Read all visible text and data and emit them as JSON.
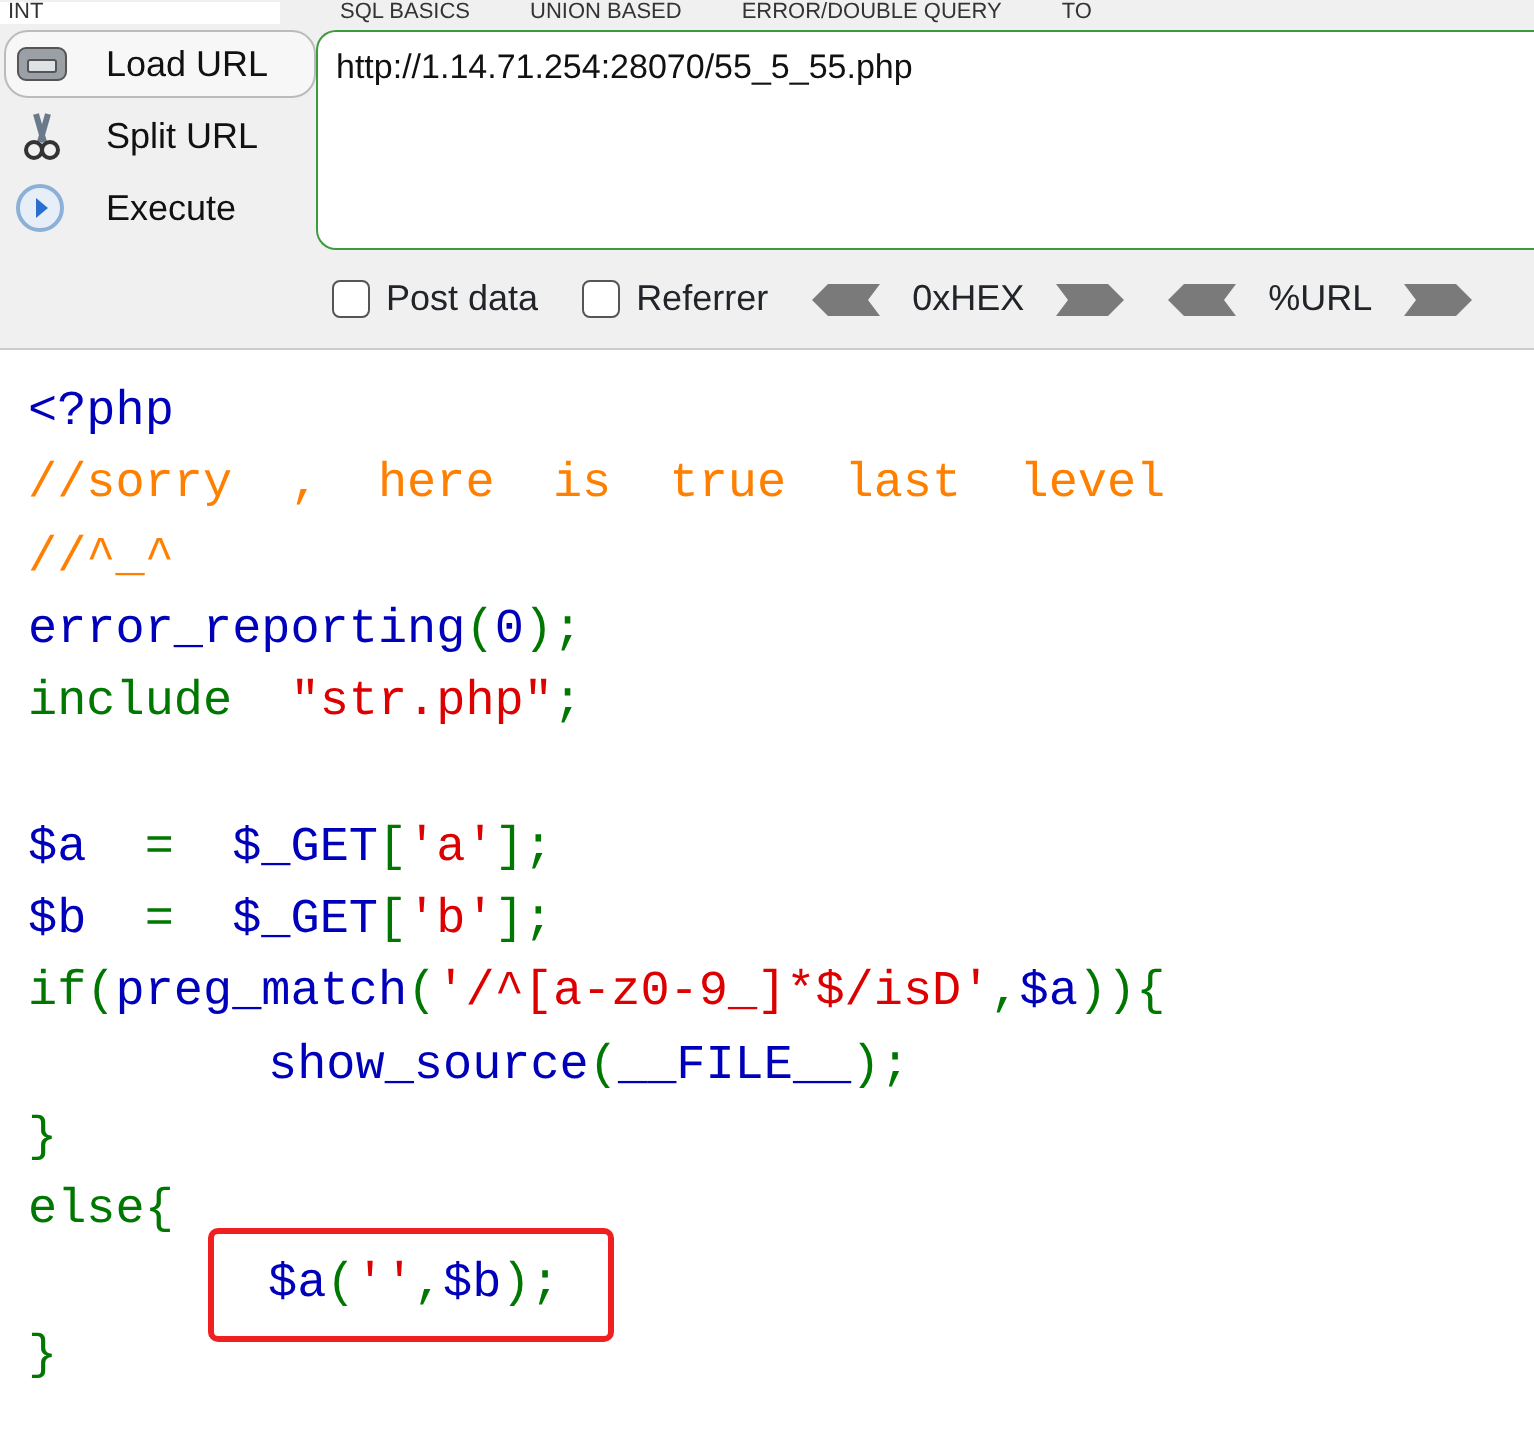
{
  "menu": {
    "field_value": "INT",
    "items": [
      "SQL BASICS",
      "UNION BASED",
      "ERROR/DOUBLE QUERY",
      "TO"
    ]
  },
  "actions": [
    {
      "label": "Load URL",
      "kind": "load",
      "selected": true
    },
    {
      "label": "Split URL",
      "kind": "split",
      "selected": false
    },
    {
      "label": "Execute",
      "kind": "execute",
      "selected": false
    }
  ],
  "url": {
    "value": "http://1.14.71.254:28070/55_5_55.php"
  },
  "options": [
    {
      "label": "Post data",
      "checked": false
    },
    {
      "label": "Referrer",
      "checked": false
    }
  ],
  "encoders": [
    "0xHEX",
    "%URL"
  ],
  "code": [
    {
      "kind": "code",
      "indented": false,
      "boxed": false,
      "tokens": [
        {
          "kind": "default",
          "text": "<?php"
        }
      ]
    },
    {
      "kind": "code",
      "indented": false,
      "boxed": false,
      "tokens": [
        {
          "kind": "comment",
          "text": "//sorry  ,  here  is  true  last  level"
        }
      ]
    },
    {
      "kind": "code",
      "indented": false,
      "boxed": false,
      "tokens": [
        {
          "kind": "comment",
          "text": "//^_^"
        }
      ]
    },
    {
      "kind": "code",
      "indented": false,
      "boxed": false,
      "tokens": [
        {
          "kind": "default",
          "text": "error_reporting"
        },
        {
          "kind": "keyword",
          "text": "("
        },
        {
          "kind": "default",
          "text": "0"
        },
        {
          "kind": "keyword",
          "text": ");"
        }
      ]
    },
    {
      "kind": "code",
      "indented": false,
      "boxed": false,
      "tokens": [
        {
          "kind": "keyword",
          "text": "include  "
        },
        {
          "kind": "string",
          "text": "\"str.php\""
        },
        {
          "kind": "keyword",
          "text": ";"
        }
      ]
    },
    {
      "kind": "blank"
    },
    {
      "kind": "code",
      "indented": false,
      "boxed": false,
      "tokens": [
        {
          "kind": "default",
          "text": "$a  "
        },
        {
          "kind": "keyword",
          "text": "=  "
        },
        {
          "kind": "default",
          "text": "$_GET"
        },
        {
          "kind": "keyword",
          "text": "["
        },
        {
          "kind": "string",
          "text": "'a'"
        },
        {
          "kind": "keyword",
          "text": "];"
        }
      ]
    },
    {
      "kind": "code",
      "indented": false,
      "boxed": false,
      "tokens": [
        {
          "kind": "default",
          "text": "$b  "
        },
        {
          "kind": "keyword",
          "text": "=  "
        },
        {
          "kind": "default",
          "text": "$_GET"
        },
        {
          "kind": "keyword",
          "text": "["
        },
        {
          "kind": "string",
          "text": "'b'"
        },
        {
          "kind": "keyword",
          "text": "];"
        }
      ]
    },
    {
      "kind": "code",
      "indented": false,
      "boxed": false,
      "tokens": [
        {
          "kind": "keyword",
          "text": "if("
        },
        {
          "kind": "default",
          "text": "preg_match"
        },
        {
          "kind": "keyword",
          "text": "("
        },
        {
          "kind": "string",
          "text": "'/^[a-z0-9_]*$/isD'"
        },
        {
          "kind": "keyword",
          "text": ","
        },
        {
          "kind": "default",
          "text": "$a"
        },
        {
          "kind": "keyword",
          "text": ")){"
        }
      ]
    },
    {
      "kind": "code",
      "indented": true,
      "boxed": false,
      "tokens": [
        {
          "kind": "default",
          "text": "show_source"
        },
        {
          "kind": "keyword",
          "text": "("
        },
        {
          "kind": "default",
          "text": "__FILE__"
        },
        {
          "kind": "keyword",
          "text": ");"
        }
      ]
    },
    {
      "kind": "code",
      "indented": false,
      "boxed": false,
      "tokens": [
        {
          "kind": "keyword",
          "text": "}"
        }
      ]
    },
    {
      "kind": "code",
      "indented": false,
      "boxed": false,
      "tokens": [
        {
          "kind": "keyword",
          "text": "else{"
        }
      ]
    },
    {
      "kind": "code",
      "indented": true,
      "boxed": true,
      "tokens": [
        {
          "kind": "default",
          "text": "$a"
        },
        {
          "kind": "keyword",
          "text": "("
        },
        {
          "kind": "string",
          "text": "''"
        },
        {
          "kind": "keyword",
          "text": ","
        },
        {
          "kind": "default",
          "text": "$b"
        },
        {
          "kind": "keyword",
          "text": ");"
        }
      ]
    },
    {
      "kind": "code",
      "indented": false,
      "boxed": false,
      "tokens": [
        {
          "kind": "keyword",
          "text": "}"
        }
      ]
    }
  ]
}
